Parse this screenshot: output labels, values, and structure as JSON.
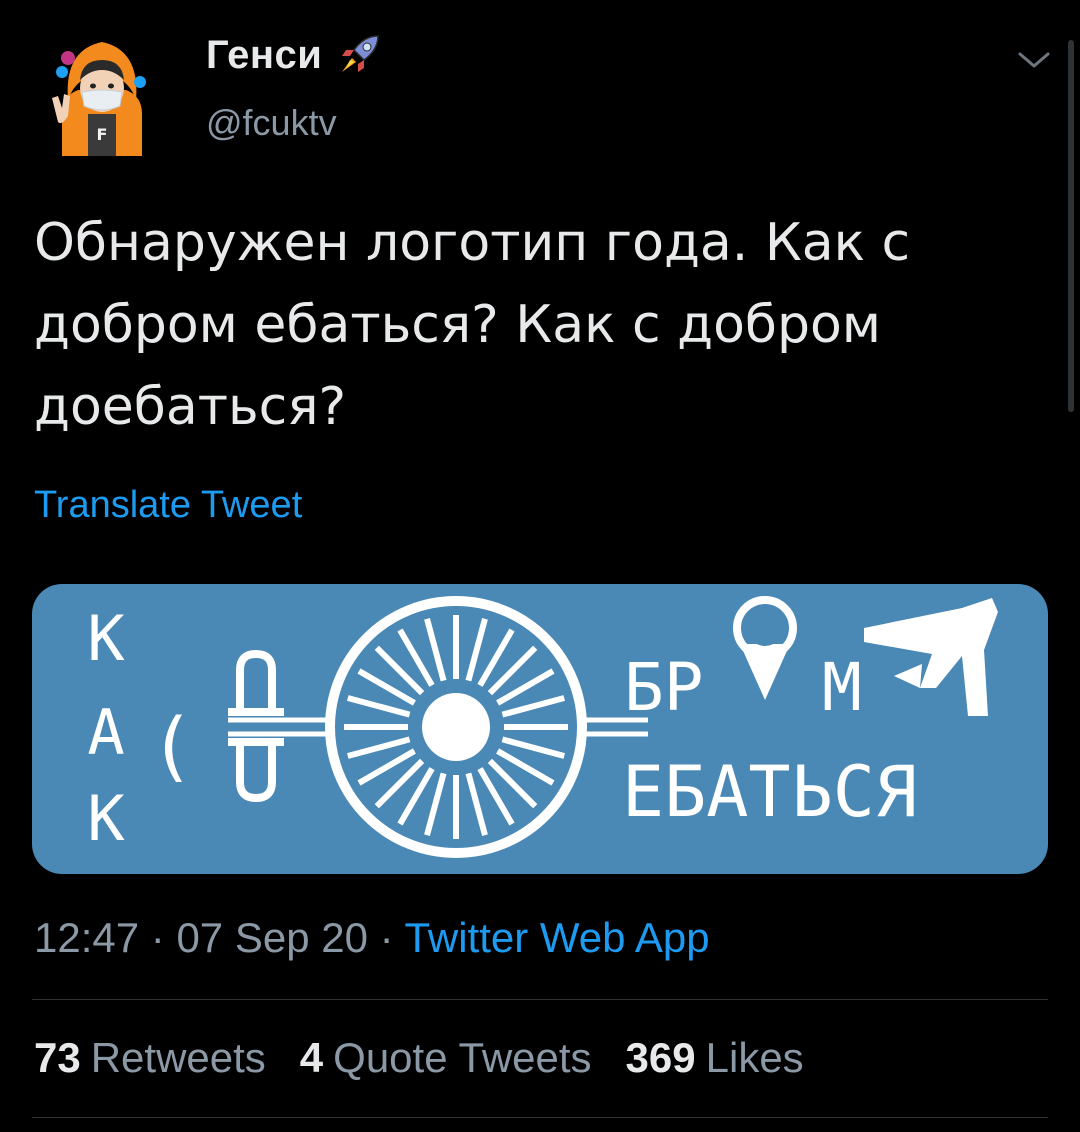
{
  "tweet": {
    "author": {
      "display_name": "Генси",
      "handle": "@fcuktv",
      "avatar_icon": "avatar-icon",
      "badge_icon": "rocket-emoji-icon"
    },
    "text": "Обнаружен логотип года. Как с добром ебаться?  Как с добром доебаться?",
    "translate_label": "Translate Tweet",
    "media": {
      "logo_text_vertical": "КАК",
      "logo_text_c": "С",
      "logo_text_do_top": "Д",
      "logo_text_do_bottom": "Д",
      "logo_text_top": "БР",
      "logo_text_top_end": "М",
      "logo_text_bottom": "ЕБАТЬСЯ"
    },
    "timestamp": {
      "time": "12:47",
      "sep1": " · ",
      "date": "07 Sep 20",
      "sep2": " · ",
      "source": "Twitter Web App"
    },
    "stats": {
      "retweets_count": "73",
      "retweets_label": "Retweets",
      "quotes_count": "4",
      "quotes_label": "Quote Tweets",
      "likes_count": "369",
      "likes_label": "Likes"
    }
  },
  "colors": {
    "background": "#000000",
    "text_primary": "#e7e9ea",
    "text_secondary": "#8b98a5",
    "link": "#1d9bf0",
    "media_bg": "#4a88b6"
  }
}
